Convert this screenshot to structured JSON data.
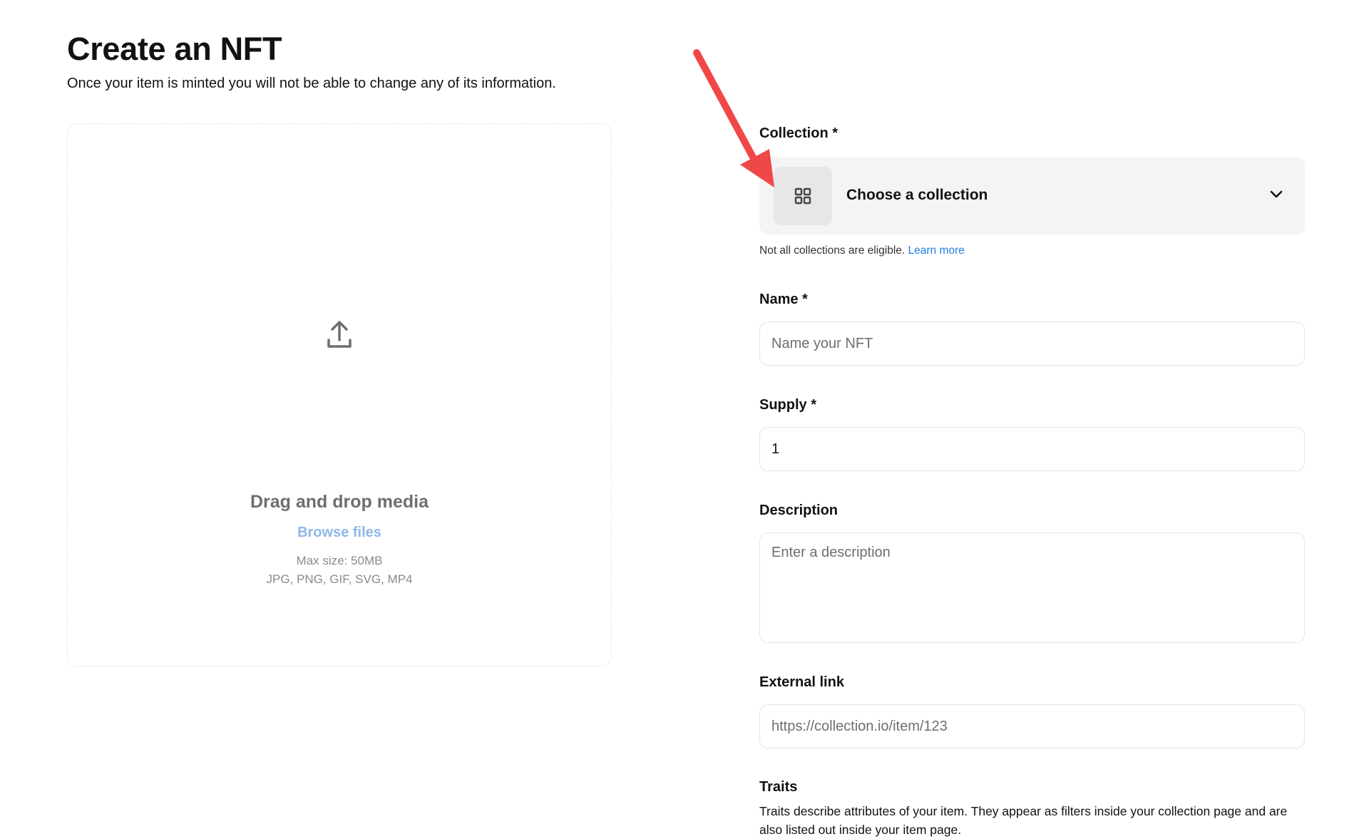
{
  "header": {
    "title": "Create an NFT",
    "subtitle": "Once your item is minted you will not be able to change any of its information."
  },
  "upload": {
    "icon": "upload-icon",
    "title": "Drag and drop media",
    "browse_label": "Browse files",
    "max_size": "Max size: 50MB",
    "formats": "JPG, PNG, GIF, SVG, MP4"
  },
  "form": {
    "collection": {
      "label": "Collection *",
      "placeholder": "Choose a collection",
      "icon": "grid-icon",
      "helper_text": "Not all collections are eligible.",
      "helper_link": "Learn more"
    },
    "name": {
      "label": "Name *",
      "placeholder": "Name your NFT"
    },
    "supply": {
      "label": "Supply *",
      "value": "1"
    },
    "description": {
      "label": "Description",
      "placeholder": "Enter a description"
    },
    "external_link": {
      "label": "External link",
      "placeholder": "https://collection.io/item/123"
    },
    "traits": {
      "label": "Traits",
      "description": "Traits describe attributes of your item. They appear as filters inside your collection page and are also listed out inside your item page."
    }
  },
  "colors": {
    "annotation_arrow": "#f04848",
    "link": "#2081e2",
    "browse_link": "#8eb8e6",
    "select_background": "#f4f4f4"
  }
}
